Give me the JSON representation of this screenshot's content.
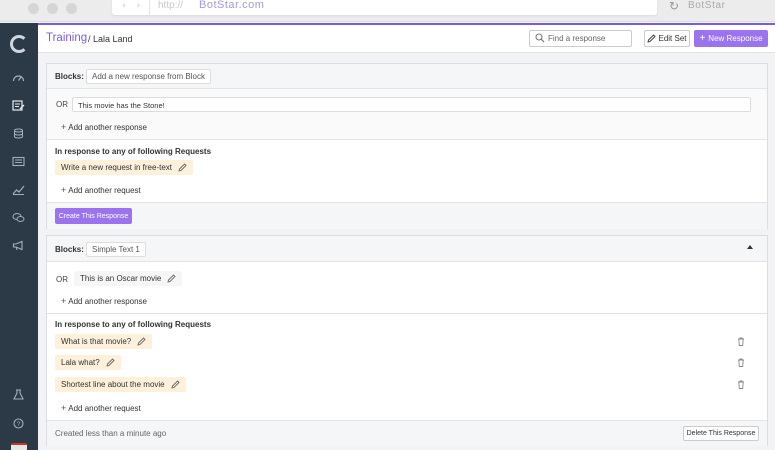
{
  "browser": {
    "url_protocol": "http://",
    "url_host": "BotStar.com",
    "brand": "BotStar"
  },
  "sidebar": {
    "items": [
      {
        "icon": "dashboard-icon"
      },
      {
        "icon": "training-icon"
      },
      {
        "icon": "database-icon"
      },
      {
        "icon": "broadcast-icon"
      },
      {
        "icon": "analytics-icon"
      },
      {
        "icon": "chat-icon"
      },
      {
        "icon": "megaphone-icon"
      }
    ],
    "bottom_items": [
      {
        "icon": "flask-icon"
      },
      {
        "icon": "help-icon"
      }
    ]
  },
  "header": {
    "breadcrumb_root": "Training",
    "breadcrumb_rest": "/ Lala Land",
    "search_placeholder": "Find a response",
    "edit_set_label": "Edit Set",
    "new_response_label": "New Response"
  },
  "card1": {
    "blocks_label": "Blocks:",
    "block_value": "Add a new response from Block",
    "or_label": "OR",
    "response_text": "This movie has the Stone!",
    "add_response_label": "Add another response",
    "requests_title": "In response to any of following Requests",
    "request_placeholder": "Write a new request in free-text",
    "add_request_label": "Add another request",
    "create_button": "Create This Response"
  },
  "card2": {
    "blocks_label": "Blocks:",
    "block_value": "Simple Text 1",
    "or_label": "OR",
    "response_text": "This is an Oscar movie",
    "add_response_label": "Add another response",
    "requests_title": "In response to any of following Requests",
    "requests": [
      {
        "text": "What is that movie?"
      },
      {
        "text": "Lala what?"
      },
      {
        "text": "Shortest line about the movie"
      }
    ],
    "add_request_label": "Add another request",
    "created_text": "Created less than a minute ago",
    "delete_button": "Delete This Response"
  },
  "colors": {
    "accent": "#7b5ce0",
    "button_purple": "#9b73ef",
    "sidebar_bg": "#2c3a48",
    "request_chip_bg": "#fdf1dc"
  }
}
